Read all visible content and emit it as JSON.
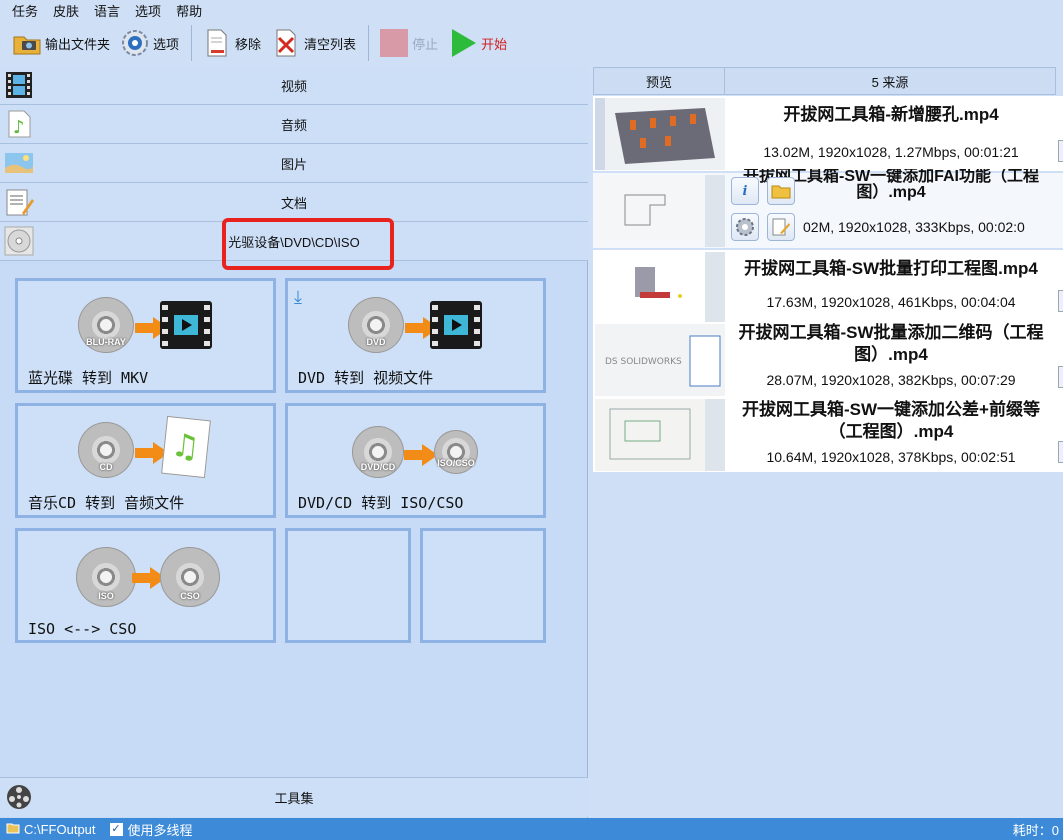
{
  "menu": [
    "任务",
    "皮肤",
    "语言",
    "选项",
    "帮助"
  ],
  "toolbar": {
    "output_folder": "输出文件夹",
    "options": "选项",
    "remove": "移除",
    "clear_list": "清空列表",
    "stop": "停止",
    "start": "开始"
  },
  "categories": [
    {
      "label": "视频",
      "icon": "film-icon"
    },
    {
      "label": "音频",
      "icon": "music-icon"
    },
    {
      "label": "图片",
      "icon": "picture-icon"
    },
    {
      "label": "文档",
      "icon": "document-icon"
    },
    {
      "label": "光驱设备\\DVD\\CD\\ISO",
      "icon": "disc-drive-icon"
    }
  ],
  "tiles": [
    {
      "label": "蓝光碟 转到 MKV",
      "disc_text": "BLU-RAY"
    },
    {
      "label": "DVD 转到 视频文件",
      "disc_text": "DVD"
    },
    {
      "label": "音乐CD 转到 音频文件",
      "disc_text": "CD"
    },
    {
      "label": "DVD/CD 转到 ISO/CSO",
      "disc_text": "DVD/CD",
      "disc2_text": "ISO/CSO"
    },
    {
      "label": "ISO <--> CSO",
      "disc_text": "ISO",
      "disc2_text": "CSO"
    }
  ],
  "toolset_label": "工具集",
  "right": {
    "preview_header": "预览",
    "sources_header": "5 来源",
    "sources": [
      {
        "title": "开拔网工具箱-新增腰孔.mp4",
        "info": "13.02M, 1920x1028, 1.27Mbps, 00:01:21"
      },
      {
        "title": "开拔网工具箱-SW一键添加FAI功能（工程图）.mp4",
        "info": "02M, 1920x1028, 333Kbps, 00:02:0"
      },
      {
        "title": "开拔网工具箱-SW批量打印工程图.mp4",
        "info": "17.63M, 1920x1028, 461Kbps, 00:04:04"
      },
      {
        "title": "开拔网工具箱-SW批量添加二维码（工程图）.mp4",
        "info": "28.07M, 1920x1028, 382Kbps, 00:07:29"
      },
      {
        "title": "开拔网工具箱-SW一键添加公差+前缀等（工程图）.mp4",
        "info": "10.64M, 1920x1028, 378Kbps, 00:02:51"
      }
    ],
    "info_button": "i"
  },
  "status": {
    "output_path": "C:\\FFOutput",
    "multithread": "使用多线程",
    "elapsed": "耗时：0"
  }
}
